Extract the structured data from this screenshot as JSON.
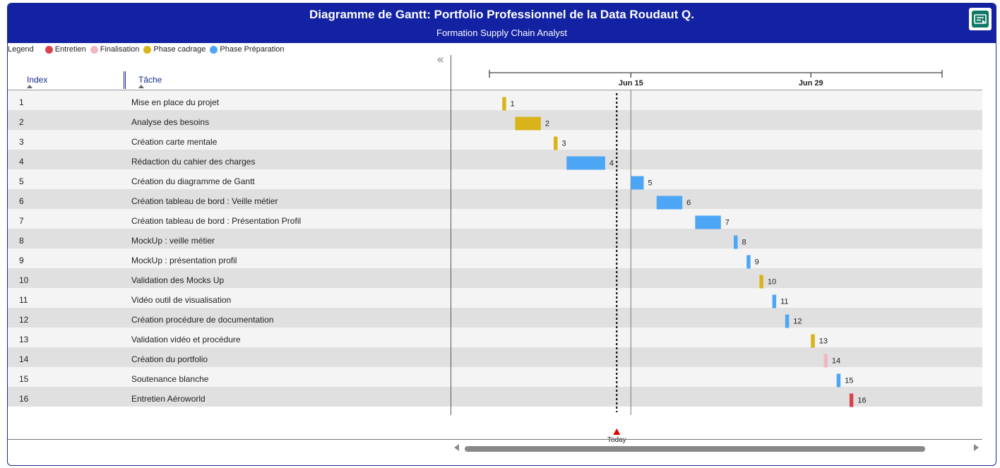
{
  "header": {
    "title": "Diagramme de Gantt: Portfolio Professionnel de la Data Roudaut Q.",
    "subtitle": "Formation Supply Chain Analyst",
    "export_icon": "export-report-icon"
  },
  "legend": {
    "title": "Legend",
    "items": [
      {
        "label": "Entretien",
        "color": "#d9434f"
      },
      {
        "label": "Finalisation",
        "color": "#f0b7bd"
      },
      {
        "label": "Phase cadrage",
        "color": "#d8b41a"
      },
      {
        "label": "Phase Préparation",
        "color": "#4da6f5"
      }
    ]
  },
  "columns": {
    "index": "Index",
    "task": "Tâche"
  },
  "collapse_icon": "double-chevron-left-icon",
  "chart_data": {
    "type": "gantt",
    "time_axis": {
      "ticks": [
        {
          "label": "Jun 15",
          "day": 15
        },
        {
          "label": "Jun 29",
          "day": 29
        }
      ],
      "range": {
        "start_day": 4.0,
        "end_day": 39.2
      }
    },
    "today": {
      "label": "Today",
      "day": 13.9
    },
    "tasks": [
      {
        "index": "1",
        "name": "Mise en place du projet",
        "phase": "Phase cadrage",
        "start": 5.0,
        "end": 5.3,
        "label": "1"
      },
      {
        "index": "2",
        "name": "Analyse des besoins",
        "phase": "Phase cadrage",
        "start": 6.0,
        "end": 8.0,
        "label": "2"
      },
      {
        "index": "3",
        "name": "Création carte mentale",
        "phase": "Phase cadrage",
        "start": 9.0,
        "end": 9.3,
        "label": "3"
      },
      {
        "index": "4",
        "name": "Rédaction du cahier des charges",
        "phase": "Phase Préparation",
        "start": 10.0,
        "end": 13.0,
        "label": "4"
      },
      {
        "index": "5",
        "name": "Création du diagramme de Gantt",
        "phase": "Phase Préparation",
        "start": 15.0,
        "end": 16.0,
        "label": "5"
      },
      {
        "index": "6",
        "name": "Création tableau de bord : Veille métier",
        "phase": "Phase Préparation",
        "start": 17.0,
        "end": 19.0,
        "label": "6"
      },
      {
        "index": "7",
        "name": "Création tableau de bord : Présentation Profil",
        "phase": "Phase Préparation",
        "start": 20.0,
        "end": 22.0,
        "label": "7"
      },
      {
        "index": "8",
        "name": "MockUp : veille métier",
        "phase": "Phase Préparation",
        "start": 23.0,
        "end": 23.3,
        "label": "8"
      },
      {
        "index": "9",
        "name": "MockUp : présentation profil",
        "phase": "Phase Préparation",
        "start": 24.0,
        "end": 24.3,
        "label": "9"
      },
      {
        "index": "10",
        "name": "Validation des Mocks Up",
        "phase": "Phase cadrage",
        "start": 25.0,
        "end": 25.3,
        "label": "10"
      },
      {
        "index": "11",
        "name": "Vidéo outil de visualisation",
        "phase": "Phase Préparation",
        "start": 26.0,
        "end": 26.3,
        "label": "11"
      },
      {
        "index": "12",
        "name": "Création procédure de documentation",
        "phase": "Phase Préparation",
        "start": 27.0,
        "end": 27.3,
        "label": "12"
      },
      {
        "index": "13",
        "name": "Validation vidéo et procédure",
        "phase": "Phase cadrage",
        "start": 29.0,
        "end": 29.3,
        "label": "13"
      },
      {
        "index": "14",
        "name": "Création du portfolio",
        "phase": "Finalisation",
        "start": 30.0,
        "end": 30.3,
        "label": "14"
      },
      {
        "index": "15",
        "name": "Soutenance blanche",
        "phase": "Phase Préparation",
        "start": 31.0,
        "end": 31.3,
        "label": "15"
      },
      {
        "index": "16",
        "name": "Entretien Aéroworld",
        "phase": "Entretien",
        "start": 32.0,
        "end": 32.3,
        "label": "16"
      }
    ]
  }
}
